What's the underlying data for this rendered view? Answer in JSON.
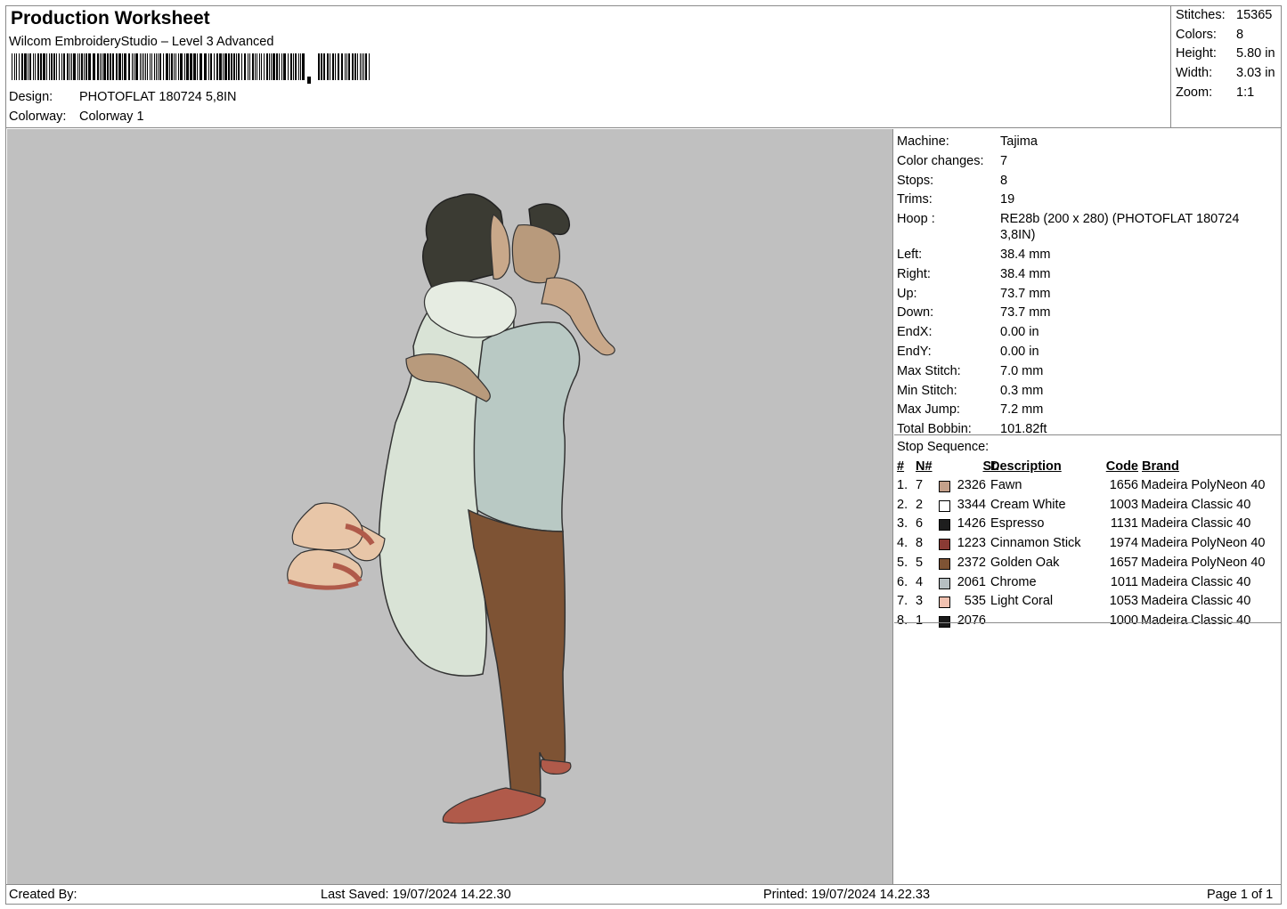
{
  "header": {
    "title": "Production Worksheet",
    "software": "Wilcom EmbroideryStudio – Level 3 Advanced",
    "design_label": "Design:",
    "design_value": "PHOTOFLAT 180724 5,8IN",
    "colorway_label": "Colorway:",
    "colorway_value": "Colorway 1"
  },
  "stats": [
    {
      "label": "Stitches:",
      "value": "15365"
    },
    {
      "label": "Colors:",
      "value": "8"
    },
    {
      "label": "Height:",
      "value": "5.80 in"
    },
    {
      "label": "Width:",
      "value": "3.03 in"
    },
    {
      "label": "Zoom:",
      "value": "1:1"
    }
  ],
  "machine_info": [
    {
      "label": "Machine:",
      "value": "Tajima"
    },
    {
      "label": "Color changes:",
      "value": "7"
    },
    {
      "label": "Stops:",
      "value": "8"
    },
    {
      "label": "Trims:",
      "value": "19"
    },
    {
      "label": "Hoop :",
      "value": "RE28b (200 x 280) (PHOTOFLAT 180724 3,8IN)"
    },
    {
      "label": "Left:",
      "value": "38.4 mm"
    },
    {
      "label": "Right:",
      "value": "38.4 mm"
    },
    {
      "label": "Up:",
      "value": "73.7 mm"
    },
    {
      "label": "Down:",
      "value": "73.7 mm"
    },
    {
      "label": "EndX:",
      "value": "0.00 in"
    },
    {
      "label": "EndY:",
      "value": "0.00 in"
    },
    {
      "label": "Max Stitch:",
      "value": "7.0 mm"
    },
    {
      "label": "Min Stitch:",
      "value": "0.3 mm"
    },
    {
      "label": "Max Jump:",
      "value": "7.2 mm"
    },
    {
      "label": "Total Bobbin:",
      "value": "101.82ft"
    }
  ],
  "stop_sequence": {
    "title": "Stop Sequence:",
    "headers": {
      "num": "#",
      "n": "N#",
      "st": "St.",
      "desc": "Description",
      "code": "Code",
      "brand": "Brand"
    },
    "rows": [
      {
        "num": "1.",
        "n": "7",
        "color": "#c4a08a",
        "st": "2326",
        "desc": "Fawn",
        "code": "1656",
        "brand": "Madeira PolyNeon 40"
      },
      {
        "num": "2.",
        "n": "2",
        "color": "#ffffff",
        "st": "3344",
        "desc": "Cream White",
        "code": "1003",
        "brand": "Madeira Classic 40"
      },
      {
        "num": "3.",
        "n": "6",
        "color": "#1e1e1e",
        "st": "1426",
        "desc": "Espresso",
        "code": "1131",
        "brand": "Madeira Classic 40"
      },
      {
        "num": "4.",
        "n": "8",
        "color": "#8a3a34",
        "st": "1223",
        "desc": "Cinnamon Stick",
        "code": "1974",
        "brand": "Madeira PolyNeon 40"
      },
      {
        "num": "5.",
        "n": "5",
        "color": "#7e5334",
        "st": "2372",
        "desc": "Golden Oak",
        "code": "1657",
        "brand": "Madeira PolyNeon 40"
      },
      {
        "num": "6.",
        "n": "4",
        "color": "#b6bfc2",
        "st": "2061",
        "desc": "Chrome",
        "code": "1011",
        "brand": "Madeira Classic 40"
      },
      {
        "num": "7.",
        "n": "3",
        "color": "#f1c1b0",
        "st": "535",
        "desc": "Light Coral",
        "code": "1053",
        "brand": "Madeira Classic 40"
      },
      {
        "num": "8.",
        "n": "1",
        "color": "#1a1a1a",
        "st": "2076",
        "desc": "",
        "code": "1000",
        "brand": "Madeira Classic 40"
      }
    ]
  },
  "footer": {
    "created_by": "Created By:",
    "last_saved": "Last Saved: 19/07/2024 14.22.30",
    "printed": "Printed: 19/07/2024 14.22.33",
    "page": "Page 1 of 1"
  }
}
